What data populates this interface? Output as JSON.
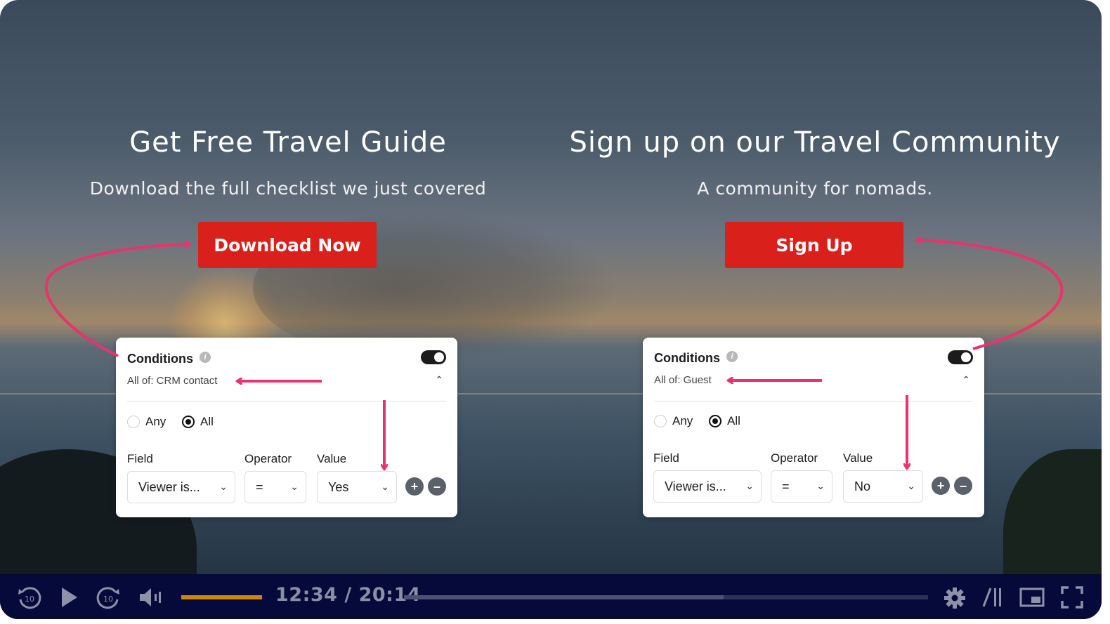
{
  "left_cta": {
    "title": "Get Free Travel Guide",
    "subtitle": "Download the full checklist we just covered",
    "button": "Download Now"
  },
  "right_cta": {
    "title": "Sign up on our Travel Community",
    "subtitle": "A community for nomads.",
    "button": "Sign Up"
  },
  "left_panel": {
    "title": "Conditions",
    "summary": "All of: CRM contact",
    "radio_any": "Any",
    "radio_all": "All",
    "selected": "All",
    "enabled": true,
    "labels": {
      "field": "Field",
      "operator": "Operator",
      "value": "Value"
    },
    "field_value": "Viewer is...",
    "operator_value": "=",
    "value_value": "Yes"
  },
  "right_panel": {
    "title": "Conditions",
    "summary": "All of: Guest",
    "radio_any": "Any",
    "radio_all": "All",
    "selected": "All",
    "enabled": true,
    "labels": {
      "field": "Field",
      "operator": "Operator",
      "value": "Value"
    },
    "field_value": "Viewer is...",
    "operator_value": "=",
    "value_value": "No"
  },
  "player": {
    "time": "12:34 / 20:14",
    "played_fraction": 0.61,
    "volume_fraction": 1.0
  },
  "colors": {
    "cta_button": "#d9201a",
    "arrow": "#e8336d",
    "player_bar": "#050a3a",
    "volume_fill": "#c68a06"
  },
  "icons": [
    "rewind-10-icon",
    "play-icon",
    "forward-10-icon",
    "volume-icon",
    "settings-gear-icon",
    "captions-icon",
    "picture-in-picture-icon",
    "fullscreen-icon",
    "info-icon",
    "chevron-up-icon",
    "chevron-down-icon",
    "plus-icon",
    "minus-icon"
  ]
}
